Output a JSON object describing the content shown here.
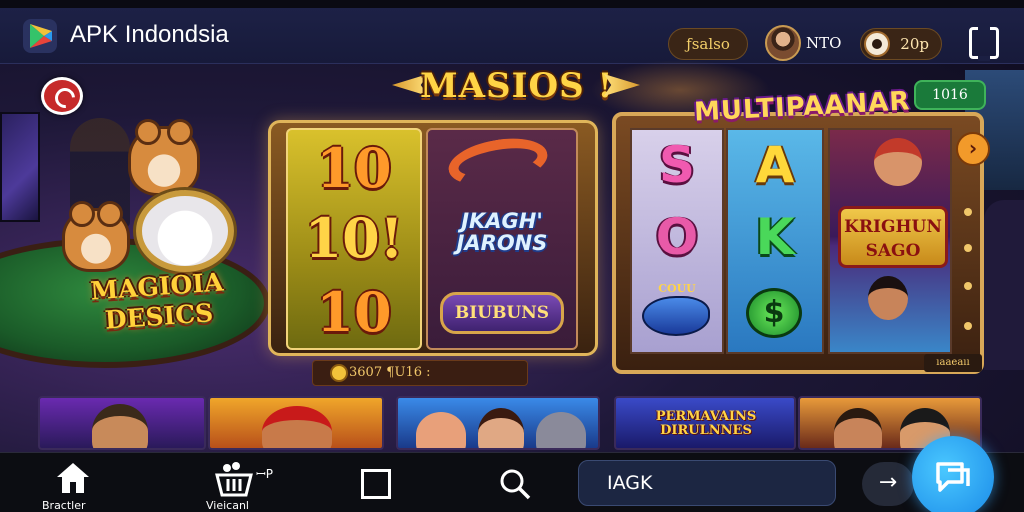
{
  "header": {
    "app_title": "APK Indondsia",
    "balance_label": "ƒsalso",
    "user_name": "NTO",
    "coins": "20p",
    "logo_icon": "play-store-logo",
    "menu_icon": "frame-icon"
  },
  "hero": {
    "main_title": "MASIOS !",
    "mascot_title": "MAGIOIA DESICS"
  },
  "slot_left": {
    "reel_numbers": [
      "10",
      "10!",
      "10"
    ],
    "reel_label": "JKAGH' JARONS",
    "reel_button": "BIUBUNS",
    "win_text": "3607 ¶U16 :"
  },
  "slot_right": {
    "title": "MULTIPAANAR",
    "multiplier_badge": "1016",
    "letters": [
      "S",
      "A",
      "O",
      "K"
    ],
    "fish_label": "COUU",
    "photo_banner": "KRIGHUN SAGO",
    "footer_text": "ıaaeaıı",
    "arrow_symbol": "›"
  },
  "thumbnails": {
    "caption": "PERMAVAINS DIRULNNES"
  },
  "bottom_nav": {
    "home_label": "Bractler",
    "basket_label": "Vieicanl",
    "basket_badge": "ꟷP",
    "search_value": "IAGK",
    "go_symbol": "→"
  },
  "colors": {
    "header_bg": "#1d2146",
    "accent_gold": "#ffd446",
    "nav_bg": "#0c0d12",
    "fab_blue": "#1a8ae8"
  }
}
